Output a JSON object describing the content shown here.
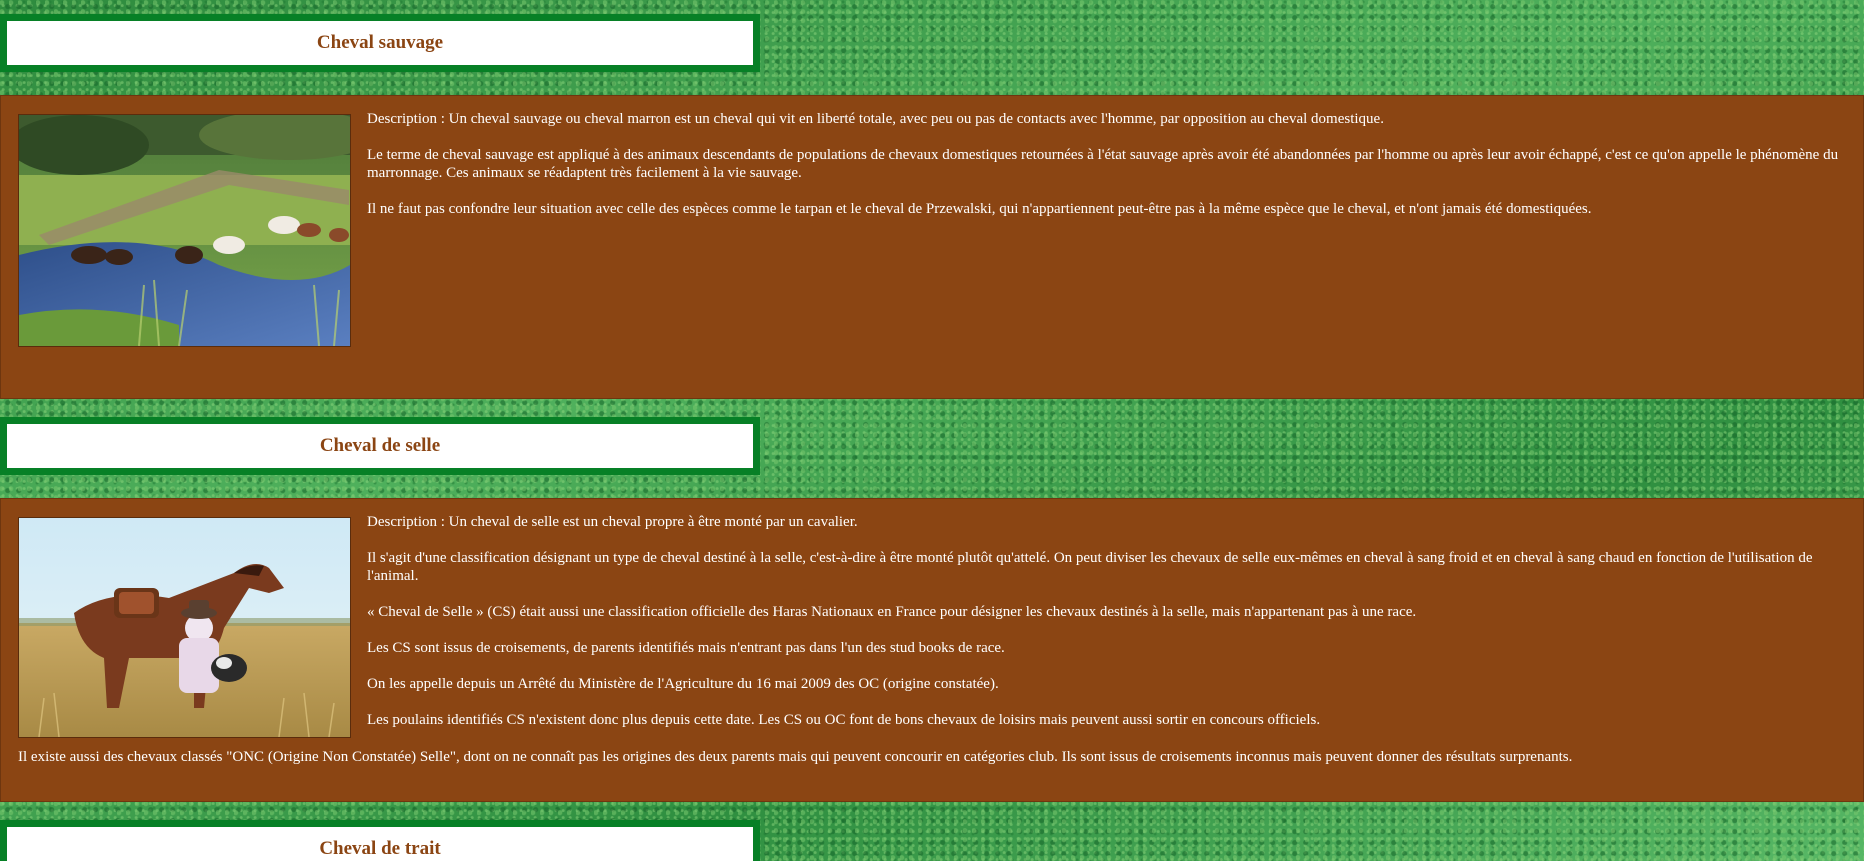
{
  "sections": [
    {
      "title": "Cheval sauvage",
      "image_alt": "wild-horses-crossing-stream",
      "paragraphs": [
        "Description : Un cheval sauvage ou cheval marron est un cheval qui vit en liberté totale, avec peu ou pas de contacts avec l'homme, par opposition au cheval domestique.",
        "Le terme de cheval sauvage est appliqué à des animaux descendants de populations de chevaux domestiques retournées à l'état sauvage après avoir été abandonnées par l'homme ou après leur avoir échappé, c'est ce qu'on appelle le phénomène du marronnage. Ces animaux se réadaptent très facilement à la vie sauvage.",
        "Il ne faut pas confondre leur situation avec celle des espèces comme le tarpan et le cheval de Przewalski, qui n'appartiennent peut-être pas à la même espèce que le cheval, et n'ont jamais été domestiquées."
      ]
    },
    {
      "title": "Cheval de selle",
      "image_alt": "cowboy-with-saddle-horse-and-dog",
      "paragraphs": [
        "Description : Un cheval de selle est un cheval propre à être monté par un cavalier.",
        "Il s'agit d'une classification désignant un type de cheval destiné à la selle, c'est-à-dire à être monté plutôt qu'attelé. On peut diviser les chevaux de selle eux-mêmes en cheval à sang froid et en cheval à sang chaud en fonction de l'utilisation de l'animal.",
        "« Cheval de Selle » (CS) était aussi une classification officielle des Haras Nationaux en France pour désigner les chevaux destinés à la selle, mais n'appartenant pas à une race.",
        "Les CS sont issus de croisements, de parents identifiés mais n'entrant pas dans l'un des stud books de race.",
        "On les appelle depuis un Arrêté du Ministère de l'Agriculture du 16 mai 2009 des OC (origine constatée).",
        "Les poulains identifiés CS n'existent donc plus depuis cette date. Les CS ou OC font de bons chevaux de loisirs mais peuvent aussi sortir en concours officiels."
      ],
      "footer_paragraph": "Il existe aussi des chevaux classés \"ONC (Origine Non Constatée) Selle\", dont on ne connaît pas les origines des deux parents mais qui peuvent concourir en catégories club. Ils sont issus de croisements inconnus mais peuvent donner des résultats surprenants."
    },
    {
      "title": "Cheval de trait"
    }
  ],
  "colors": {
    "heading_text": "#8b4513",
    "heading_border": "#078026",
    "section_bg": "#8b4513",
    "section_text": "#ffffff",
    "grass": "#3a9a4a"
  }
}
